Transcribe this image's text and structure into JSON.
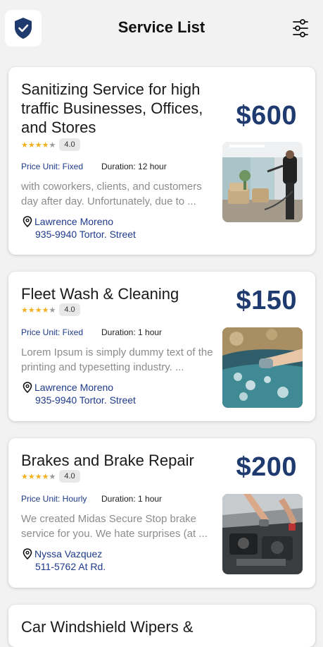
{
  "header": {
    "title": "Service List",
    "logo_icon": "shield-check-icon",
    "filter_icon": "sliders-icon"
  },
  "colors": {
    "accent": "#1e3a6e",
    "link": "#1e3a8a",
    "star": "#f2b01e",
    "background": "#f2f2f2"
  },
  "services": [
    {
      "title": "Sanitizing Service for high traffic Businesses, Offices, and Stores",
      "price": "$600",
      "rating": "4.0",
      "stars_filled": 4,
      "price_unit": "Price Unit: Fixed",
      "duration": "Duration: 12 hour",
      "description": "with coworkers, clients, and customers day after day. Unfortunately, due to ...",
      "provider": "Lawrence Moreno",
      "address": "935-9940 Tortor. Street",
      "image": "sanitizing-photo"
    },
    {
      "title": "Fleet Wash & Cleaning",
      "price": "$150",
      "rating": "4.0",
      "stars_filled": 4,
      "price_unit": "Price Unit: Fixed",
      "duration": "Duration: 1 hour",
      "description": "Lorem Ipsum is simply dummy text of the printing and typesetting industry. ...",
      "provider": "Lawrence Moreno",
      "address": "935-9940 Tortor. Street",
      "image": "car-wash-photo"
    },
    {
      "title": "Brakes and Brake Repair",
      "price": "$200",
      "rating": "4.0",
      "stars_filled": 4,
      "price_unit": "Price Unit: Hourly",
      "duration": "Duration: 1 hour",
      "description": "We created Midas Secure Stop brake service for you. We hate surprises (at ...",
      "provider": "Nyssa Vazquez",
      "address": "511-5762 At Rd.",
      "image": "engine-repair-photo"
    },
    {
      "title": "Car Windshield Wipers &"
    }
  ]
}
